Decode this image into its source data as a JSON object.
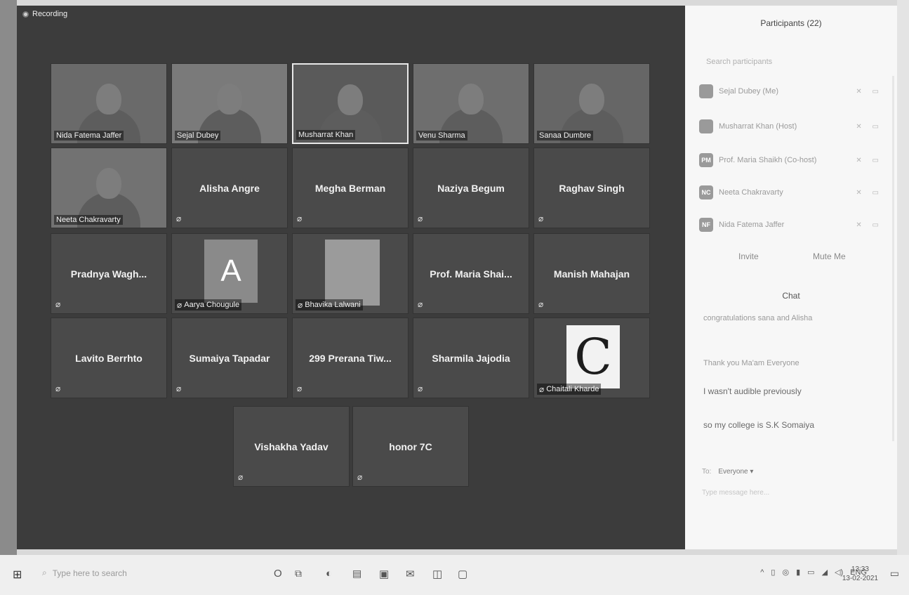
{
  "recording": {
    "label": "Recording"
  },
  "tiles": [
    {
      "name": "Nida Fatema Jaffer",
      "kind": "video"
    },
    {
      "name": "Sejal Dubey",
      "kind": "video"
    },
    {
      "name": "Musharrat Khan",
      "kind": "video",
      "active": true
    },
    {
      "name": "Venu Sharma",
      "kind": "video"
    },
    {
      "name": "Sanaa Dumbre",
      "kind": "video"
    },
    {
      "name": "Neeta Chakravarty",
      "kind": "video"
    },
    {
      "name": "Alisha Angre",
      "kind": "name"
    },
    {
      "name": "Megha Berman",
      "kind": "name"
    },
    {
      "name": "Naziya Begum",
      "kind": "name"
    },
    {
      "name": "Raghav Singh",
      "kind": "name"
    },
    {
      "name": "Pradnya  Wagh...",
      "kind": "name"
    },
    {
      "name": "Aarya Chougule",
      "kind": "avatar",
      "avatar": "A"
    },
    {
      "name": "Bhavika Lalwani",
      "kind": "photo"
    },
    {
      "name": "Prof. Maria Shai...",
      "kind": "name"
    },
    {
      "name": "Manish Mahajan",
      "kind": "name"
    },
    {
      "name": "Lavito Berrhto",
      "kind": "name"
    },
    {
      "name": "Sumaiya Tapadar",
      "kind": "name"
    },
    {
      "name": "299 Prerana Tiw...",
      "kind": "name"
    },
    {
      "name": "Sharmila Jajodia",
      "kind": "name"
    },
    {
      "name": "Chaitali Kharde",
      "kind": "avatar-c",
      "avatar": "C"
    },
    {
      "name": "Vishakha Yadav",
      "kind": "name"
    },
    {
      "name": "honor 7C",
      "kind": "name"
    }
  ],
  "participants_panel": {
    "title": "Participants (22)",
    "search_placeholder": "Search participants",
    "list": [
      {
        "initials": "",
        "name": "Sejal Dubey (Me)"
      },
      {
        "initials": "",
        "name": "Musharrat Khan (Host)"
      },
      {
        "initials": "PM",
        "name": "Prof. Maria Shaikh (Co-host)"
      },
      {
        "initials": "NC",
        "name": "Neeta Chakravarty"
      },
      {
        "initials": "NF",
        "name": "Nida Fatema Jaffer"
      }
    ],
    "invite": "Invite",
    "mute_me": "Mute Me"
  },
  "chat": {
    "title": "Chat",
    "messages": [
      "congratulations sana and Alisha",
      "Thank you Ma'am Everyone",
      "I wasn't audible previously",
      "so my college is S.K Somaiya"
    ],
    "to_label": "To:",
    "to_value": "Everyone ▾",
    "input_placeholder": "Type message here..."
  },
  "taskbar": {
    "search_placeholder": "Type here to search",
    "lang": "ENG",
    "time": "13:33",
    "date": "13-02-2021"
  }
}
